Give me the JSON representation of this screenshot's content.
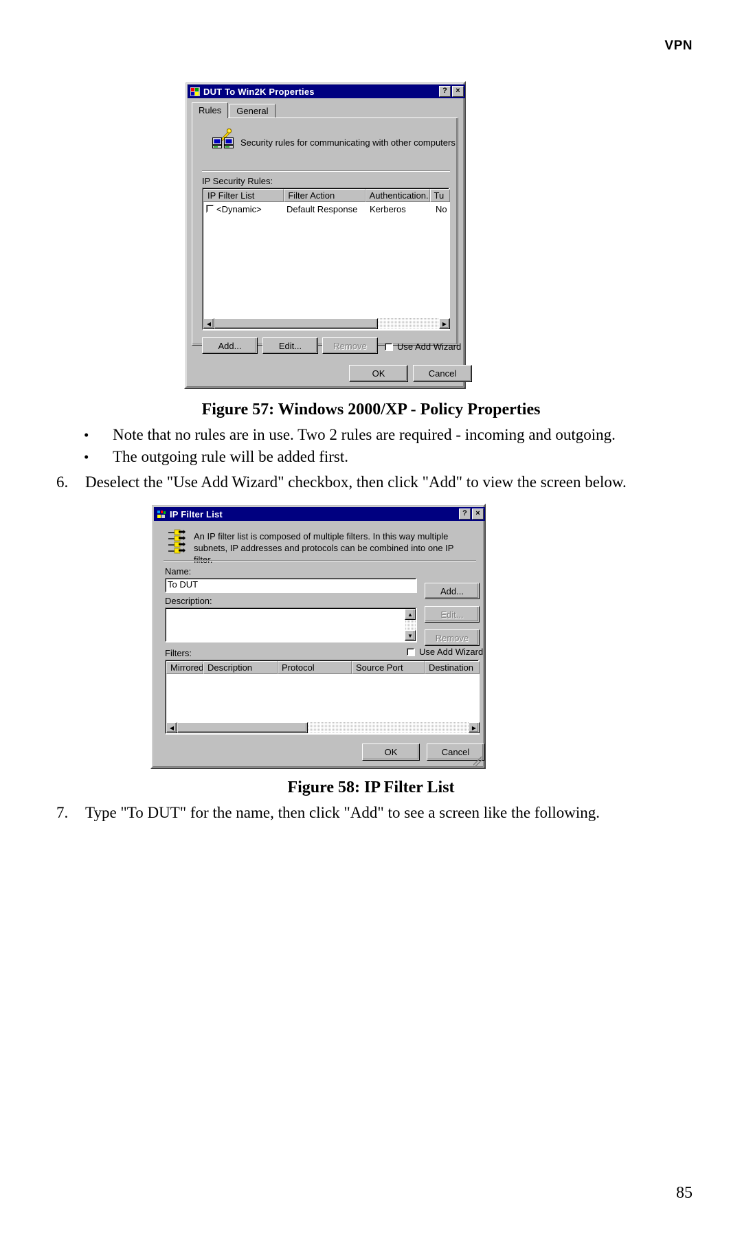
{
  "page": {
    "running_head": "VPN",
    "page_number": "85"
  },
  "figure57": {
    "caption": "Figure 57: Windows 2000/XP - Policy Properties",
    "dialog": {
      "title": "DUT To Win2K Properties",
      "titlebar_buttons": {
        "help": "?",
        "close": "×"
      },
      "tabs": [
        {
          "label": "Rules",
          "active": true
        },
        {
          "label": "General",
          "active": false
        }
      ],
      "description": "Security rules for communicating with other computers",
      "list_label": "IP Security Rules:",
      "columns": [
        "IP Filter List",
        "Filter Action",
        "Authentication...",
        "Tu"
      ],
      "rows": [
        {
          "checked": false,
          "ip_filter_list": "<Dynamic>",
          "filter_action": "Default Response",
          "authentication": "Kerberos",
          "tunnel": "No"
        }
      ],
      "buttons": {
        "add": "Add...",
        "edit": "Edit...",
        "remove": "Remove",
        "ok": "OK",
        "cancel": "Cancel"
      },
      "checkbox": {
        "label": "Use Add Wizard",
        "checked": false
      },
      "icons": {
        "title": "shield-icon",
        "banner": "key-computers-icon"
      }
    }
  },
  "figure58": {
    "caption": "Figure 58: IP Filter List",
    "dialog": {
      "title": "IP Filter List",
      "titlebar_buttons": {
        "help": "?",
        "close": "×"
      },
      "description": "An IP filter list is composed of multiple filters. In this way multiple subnets, IP addresses and protocols can be combined into one IP filter.",
      "name_label": "Name:",
      "name_value": "To DUT",
      "description_label": "Description:",
      "description_value": "",
      "filters_label": "Filters:",
      "columns": [
        "Mirrored",
        "Description",
        "Protocol",
        "Source Port",
        "Destination"
      ],
      "rows": [],
      "buttons": {
        "add": "Add...",
        "edit": "Edit...",
        "remove": "Remove",
        "ok": "OK",
        "cancel": "Cancel"
      },
      "checkbox": {
        "label": "Use Add Wizard",
        "checked": false
      },
      "icons": {
        "banner": "filter-list-icon"
      }
    }
  },
  "body": {
    "bullets": [
      "Note that no rules are in use. Two 2 rules are required - incoming and outgoing.",
      "The outgoing rule will be added first."
    ],
    "steps": [
      {
        "number": "6.",
        "text": "Deselect the \"Use Add Wizard\" checkbox, then click \"Add\" to view the screen below."
      },
      {
        "number": "7.",
        "text": "Type \"To DUT\" for the name, then click \"Add\" to see a screen like the following."
      }
    ]
  }
}
